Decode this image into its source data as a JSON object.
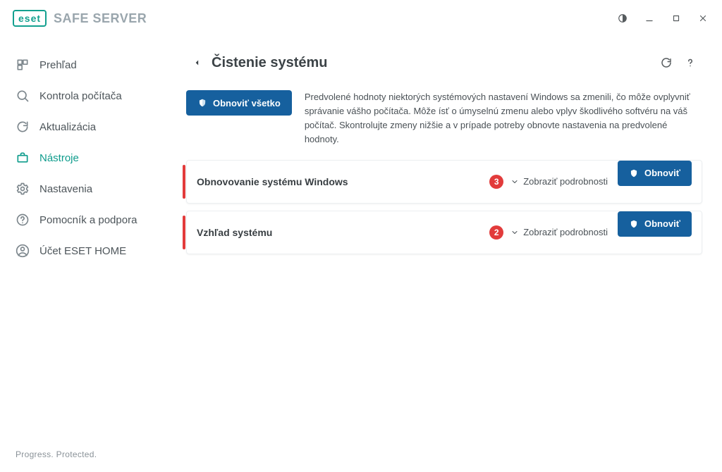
{
  "app": {
    "brand": "eset",
    "product": "SAFE SERVER",
    "footer": "Progress. Protected."
  },
  "sidebar": {
    "items": [
      {
        "label": "Prehľad"
      },
      {
        "label": "Kontrola počítača"
      },
      {
        "label": "Aktualizácia"
      },
      {
        "label": "Nástroje"
      },
      {
        "label": "Nastavenia"
      },
      {
        "label": "Pomocník a podpora"
      },
      {
        "label": "Účet ESET HOME"
      }
    ]
  },
  "page": {
    "title": "Čistenie systému",
    "restore_all": "Obnoviť všetko",
    "description": "Predvolené hodnoty niektorých systémových nastavení Windows sa zmenili, čo môže ovplyvniť správanie vášho počítača. Môže ísť o úmyselnú zmenu alebo vplyv škodlivého softvéru na váš počítač. Skontrolujte zmeny nižšie a v prípade potreby obnovte nastavenia na predvolené hodnoty.",
    "details_label": "Zobraziť podrobnosti",
    "restore_label": "Obnoviť",
    "cards": [
      {
        "title": "Obnovovanie systému Windows",
        "count": "3"
      },
      {
        "title": "Vzhľad systému",
        "count": "2"
      }
    ]
  }
}
